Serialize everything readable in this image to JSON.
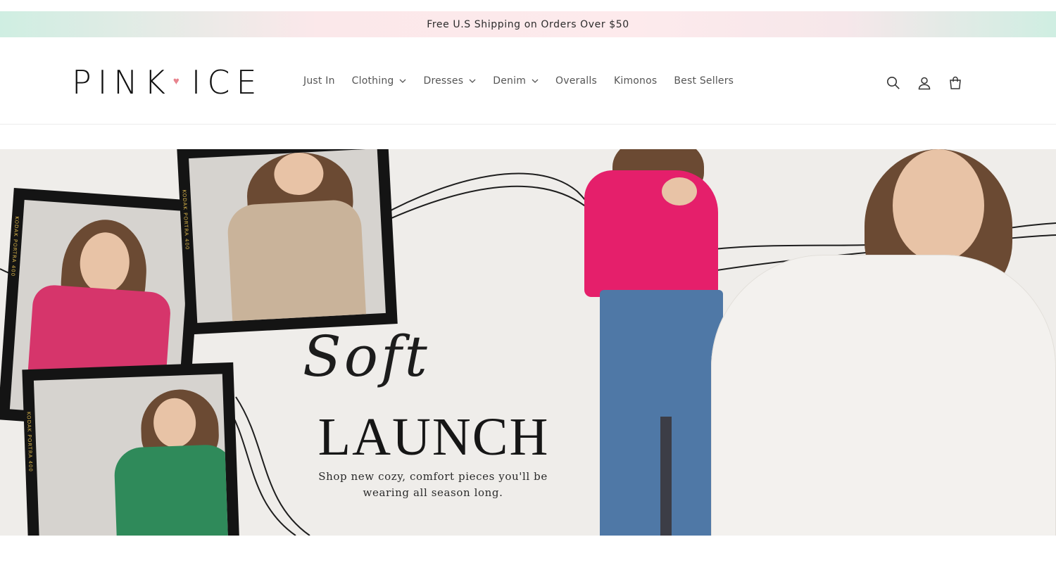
{
  "announcement": "Free U.S Shipping on Orders Over $50",
  "brand": {
    "name_left": "PINK",
    "name_right": "ICE",
    "heart": "♥",
    "accent": "#e8848e"
  },
  "nav": {
    "items": [
      {
        "label": "Just In",
        "has_dropdown": false
      },
      {
        "label": "Clothing",
        "has_dropdown": true
      },
      {
        "label": "Dresses",
        "has_dropdown": true
      },
      {
        "label": "Denim",
        "has_dropdown": true
      },
      {
        "label": "Overalls",
        "has_dropdown": false
      },
      {
        "label": "Kimonos",
        "has_dropdown": false
      },
      {
        "label": "Best Sellers",
        "has_dropdown": false
      }
    ],
    "icons": [
      "search-icon",
      "account-icon",
      "cart-icon"
    ]
  },
  "hero": {
    "script_word": "Soft",
    "title": "LAUNCH",
    "subtitle_line1": "Shop new cozy, comfort pieces you'll be",
    "subtitle_line2": "wearing all season long.",
    "film_text": "KODAK PORTRA 400",
    "colors": {
      "pink_vest": "#d6356b",
      "tan_vest": "#c9b39a",
      "green_vest": "#2f8a5a",
      "pink_sweater": "#e51f6b",
      "denim": "#4f78a6",
      "white_sweater": "#f3f1ee"
    }
  }
}
